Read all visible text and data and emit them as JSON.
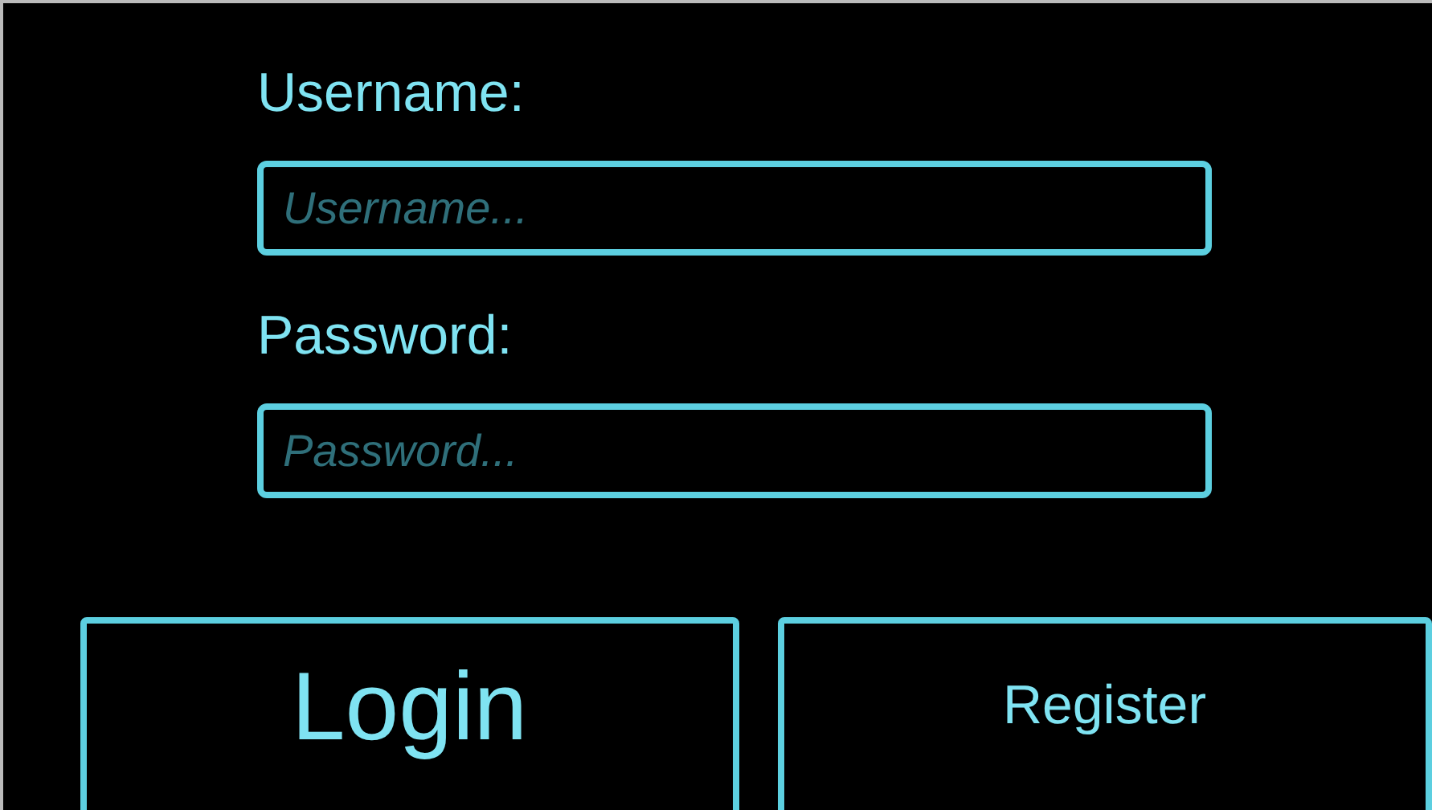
{
  "fields": [
    {
      "label": "Username:",
      "placeholder": "Username..."
    },
    {
      "label": "Password:",
      "placeholder": "Password..."
    }
  ],
  "buttons": [
    {
      "label": "Login",
      "kind": "primary"
    },
    {
      "label": "Register",
      "kind": "secondary"
    }
  ]
}
